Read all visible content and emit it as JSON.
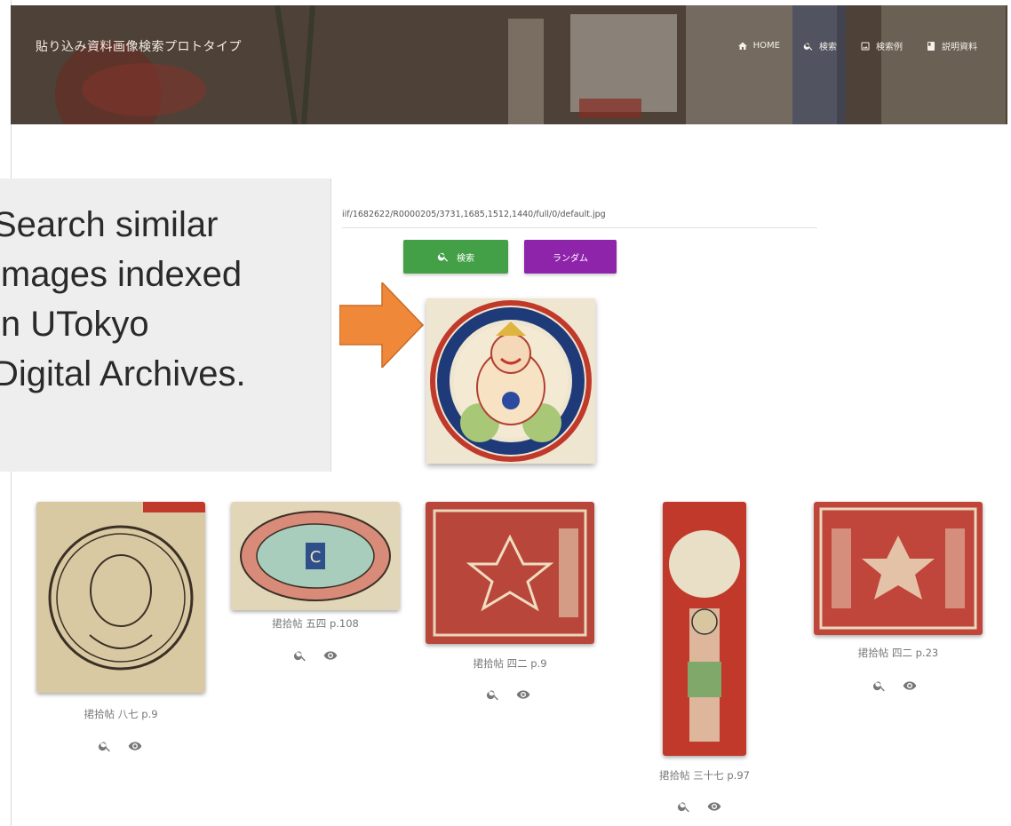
{
  "header": {
    "title": "貼り込み資料画像検索プロトタイプ",
    "nav": [
      {
        "label": "HOME",
        "icon": "home-icon"
      },
      {
        "label": "検索",
        "icon": "search-icon"
      },
      {
        "label": "検索例",
        "icon": "image-icon"
      },
      {
        "label": "説明資料",
        "icon": "book-icon"
      }
    ]
  },
  "search": {
    "url_value": "iif/1682622/R0000205/3731,1685,1512,1440/full/0/default.jpg",
    "search_button_label": "検索",
    "random_button_label": "ランダム"
  },
  "callout": {
    "text": "Search similar\nimages indexed\nin UTokyo\nDigital Archives."
  },
  "results": [
    {
      "label": "捃拾帖 八七 p.9",
      "search_icon": "search-icon",
      "view_icon": "eye-icon"
    },
    {
      "label": "捃拾帖 五四 p.108",
      "search_icon": "search-icon",
      "view_icon": "eye-icon"
    },
    {
      "label": "捃拾帖 四二 p.9",
      "search_icon": "search-icon",
      "view_icon": "eye-icon"
    },
    {
      "label": "捃拾帖 三十七 p.97",
      "search_icon": "search-icon",
      "view_icon": "eye-icon"
    },
    {
      "label": "捃拾帖 四二 p.23",
      "search_icon": "search-icon",
      "view_icon": "eye-icon"
    }
  ],
  "colors": {
    "search_button": "#43a047",
    "random_button": "#8e24aa",
    "arrow": "#f0883a"
  }
}
